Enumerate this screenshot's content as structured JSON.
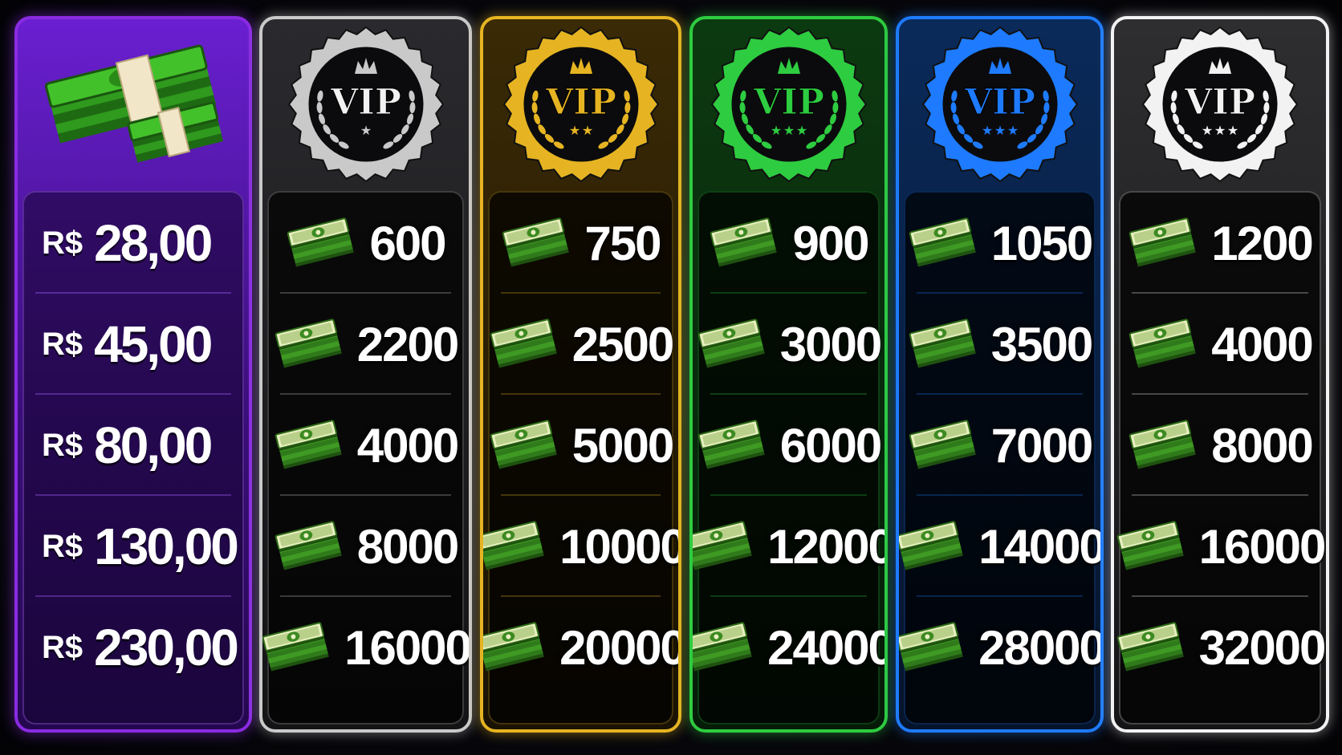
{
  "currency_symbol": "R$",
  "prices": [
    "28,00",
    "45,00",
    "80,00",
    "130,00",
    "230,00"
  ],
  "badge_label": "VIP",
  "tiers": [
    {
      "name": "vip-silver",
      "stars": 1,
      "accent": "#c9c9c9",
      "amounts": [
        "600",
        "2200",
        "4000",
        "8000",
        "16000"
      ]
    },
    {
      "name": "vip-gold",
      "stars": 2,
      "accent": "#e6b422",
      "amounts": [
        "750",
        "2500",
        "5000",
        "10000",
        "20000"
      ]
    },
    {
      "name": "vip-green",
      "stars": 3,
      "accent": "#2ecc40",
      "amounts": [
        "900",
        "3000",
        "6000",
        "12000",
        "24000"
      ]
    },
    {
      "name": "vip-blue",
      "stars": 3,
      "accent": "#1e7bff",
      "amounts": [
        "1050",
        "3500",
        "7000",
        "14000",
        "28000"
      ]
    },
    {
      "name": "vip-white",
      "stars": 3,
      "accent": "#f2f2f2",
      "amounts": [
        "1200",
        "4000",
        "8000",
        "16000",
        "32000"
      ]
    }
  ],
  "icons": {
    "header": "money-stack-icon",
    "row": "cash-bundle-icon",
    "badge": "vip-badge-icon"
  }
}
